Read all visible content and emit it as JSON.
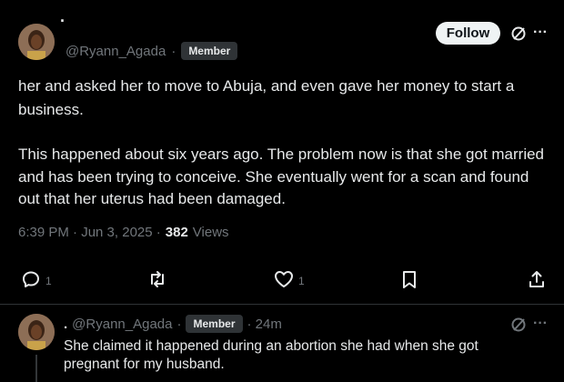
{
  "top_partial": "·",
  "main_tweet": {
    "handle": "@Ryann_Agada",
    "dot": "·",
    "badge": "Member",
    "follow_label": "Follow",
    "more_glyph": "···",
    "text_p1": "her and asked her to move to Abuja, and even gave her money to start a business.",
    "text_p2": "This happened about six years ago. The problem now is that she got married and has been trying to conceive. She eventually went for a scan and found out that her uterus had been damaged.",
    "time": "6:39 PM · Jun 3, 2025 ·",
    "views_count": "382",
    "views_label": "Views",
    "actions": {
      "reply_count": "1",
      "like_count": "1"
    }
  },
  "reply_tweet": {
    "lead_dot": ".",
    "handle": "@Ryann_Agada",
    "dot": "·",
    "badge": "Member",
    "age": "· 24m",
    "more_glyph": "···",
    "text": "She claimed it happened during an abortion she had when she got pregnant for my husband."
  },
  "colors": {
    "background": "#000000",
    "text": "#e7e9ea",
    "muted": "#71767b",
    "divider": "#2f3336",
    "follow_bg": "#eff3f4"
  },
  "icons": [
    "grok-icon",
    "more-icon",
    "reply-icon",
    "retweet-icon",
    "like-icon",
    "bookmark-icon",
    "share-icon"
  ]
}
